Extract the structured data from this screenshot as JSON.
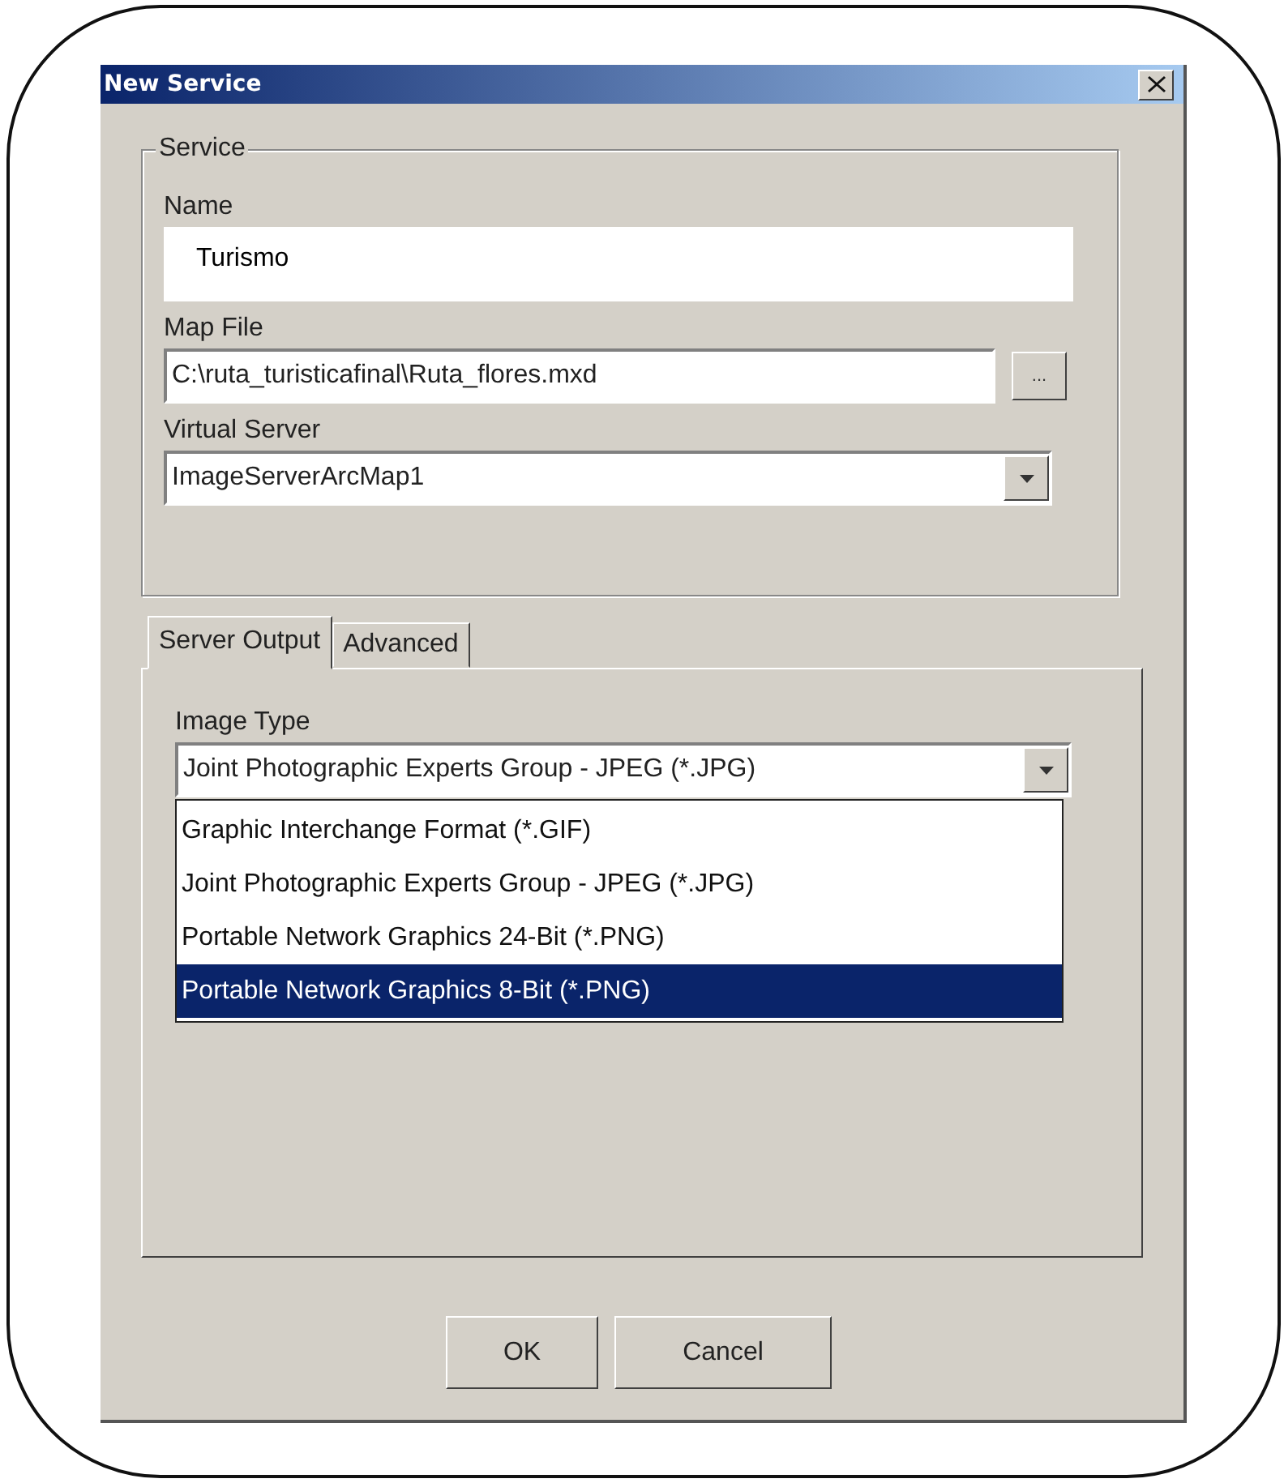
{
  "window": {
    "title": "New Service"
  },
  "service_group": {
    "legend": "Service",
    "fields": [
      {
        "kind": "text",
        "label": "Name",
        "value": "Turismo"
      },
      {
        "kind": "file",
        "label": "Map File",
        "value": "C:\\ruta_turisticafinal\\Ruta_flores.mxd",
        "browse": "..."
      },
      {
        "kind": "combo",
        "label": "Virtual Server",
        "value": "ImageServerArcMap1"
      }
    ]
  },
  "tabs": [
    {
      "label": "Server Output",
      "selected": true
    },
    {
      "label": "Advanced",
      "selected": false
    }
  ],
  "image_type": {
    "label": "Image Type",
    "value": "Joint Photographic Experts Group - JPEG (*.JPG)",
    "options": [
      {
        "label": "Graphic Interchange Format (*.GIF)",
        "highlighted": false
      },
      {
        "label": "Joint Photographic Experts Group - JPEG (*.JPG)",
        "highlighted": false
      },
      {
        "label": "Portable Network Graphics 24-Bit (*.PNG)",
        "highlighted": false
      },
      {
        "label": "Portable Network Graphics 8-Bit (*.PNG)",
        "highlighted": true
      }
    ]
  },
  "buttons": [
    "OK",
    "Cancel"
  ]
}
